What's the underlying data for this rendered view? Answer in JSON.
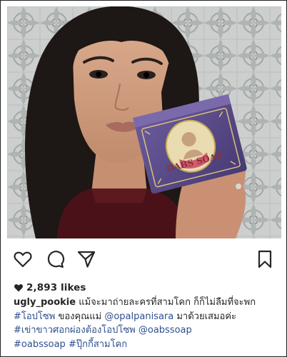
{
  "post": {
    "username": "ugly_pookie",
    "likes": "2,893 likes",
    "caption_lines": [
      {
        "pre": "",
        "text": " แม้จะมาถ่ายละครที่สามโคก ก็ก็ไม่ลืมที่จะพก"
      },
      {
        "tag": "#โอปโซพ",
        "text": " ของคุณแม่ ",
        "mention": "@opalpanisara",
        "post": " มาด้วยเสมอค่ะ"
      },
      {
        "tag": "#เข่าขาวศอกผ่องต้องโอปโซพ",
        "mention": "@oabssoap"
      },
      {
        "tag": "#oabssoap",
        "tag2": "#ปุ๊กกี้สามโคก"
      }
    ]
  },
  "product": {
    "box_text": "OABS SOAP"
  },
  "icons": [
    "heart-outline-icon",
    "comment-icon",
    "share-icon",
    "bookmark-icon",
    "heart-filled-icon"
  ],
  "colors": {
    "link": "#2f4f8f",
    "text": "#262626",
    "box": "#5a4a8a"
  }
}
